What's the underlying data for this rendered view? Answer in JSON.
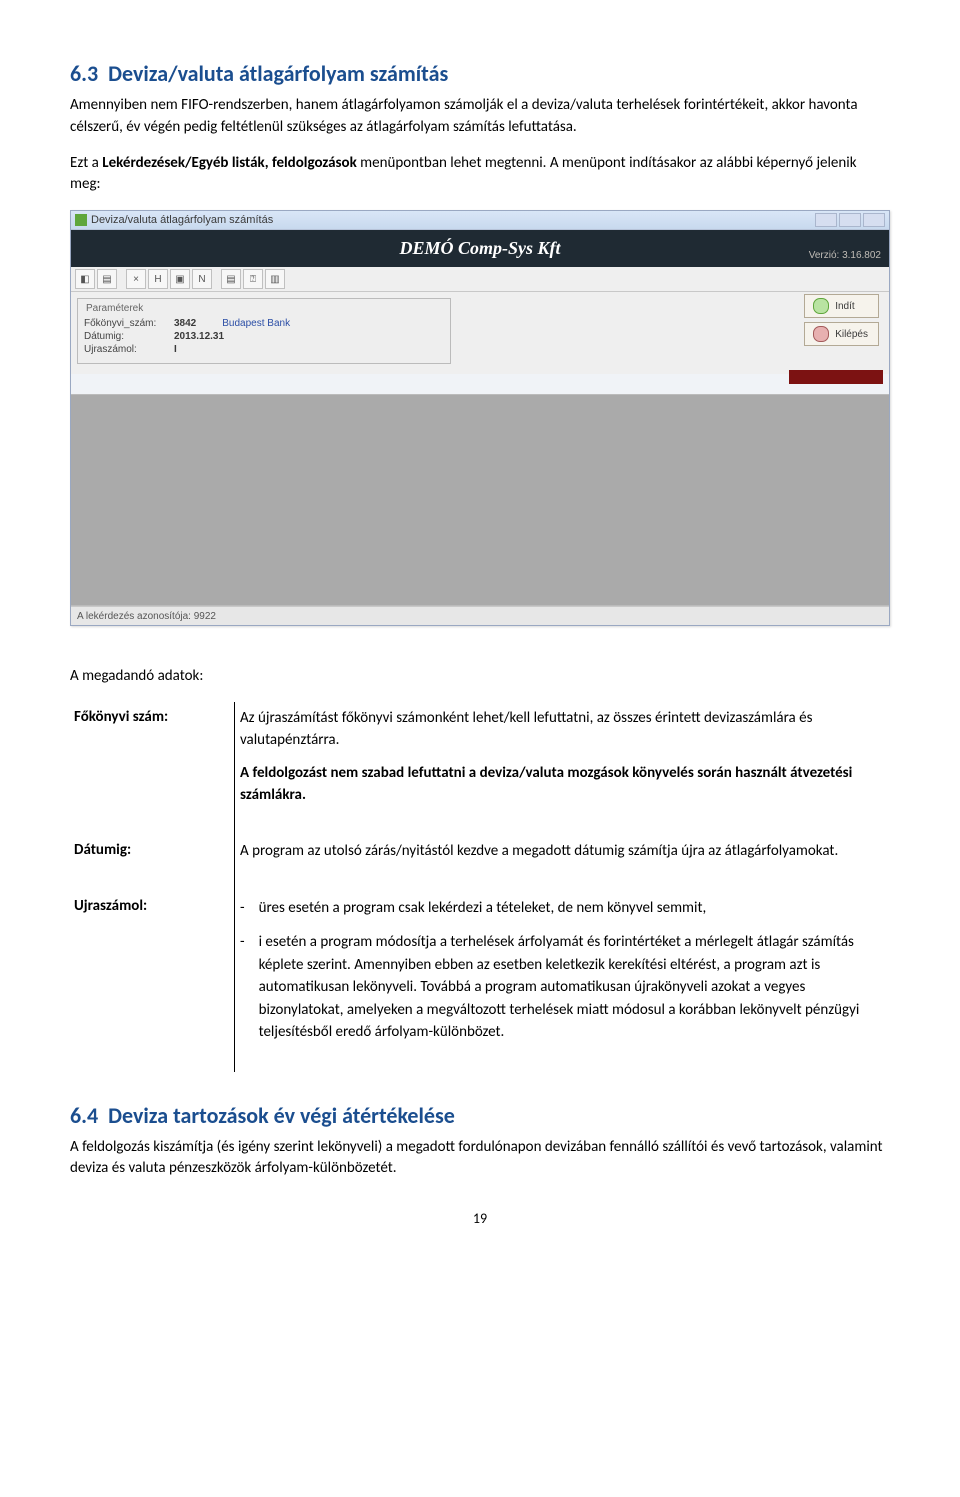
{
  "section63": {
    "number": "6.3",
    "title": "Deviza/valuta átlagárfolyam számítás",
    "para1": "Amennyiben nem FIFO-rendszerben, hanem átlagárfolyamon számolják el a deviza/valuta terhelések forintértékeit, akkor havonta célszerű, év végén pedig feltétlenül szükséges az átlagárfolyam számítás lefuttatása.",
    "para2a": "Ezt a ",
    "para2b": "Lekérdezések/Egyéb listák, feldolgozások",
    "para2c": " menüpontban lehet megtenni. A menüpont indításakor az alábbi képernyő jelenik meg:"
  },
  "win": {
    "title": "Deviza/valuta átlagárfolyam számítás",
    "banner": "DEMÓ Comp-Sys Kft",
    "version": "Verzió: 3.16.802",
    "params_title": "Paraméterek",
    "row1_label": "Főkönyvi_szám:",
    "row1_value": "3842",
    "row1_value2": "Budapest Bank",
    "row2_label": "Dátumig:",
    "row2_value": "2013.12.31",
    "row3_label": "Ujraszámol:",
    "row3_value": "I",
    "btn_start": "Indít",
    "btn_stop": "Kilépés",
    "status": "A lekérdezés azonosítója: 9922"
  },
  "defs": {
    "intro": "A megadandó adatok:",
    "fokonyvi_term": "Főkönyvi szám:",
    "fokonyvi_p1": "Az újraszámítást főkönyvi számonként lehet/kell lefuttatni, az összes érintett devizaszámlára és valutapénztárra.",
    "fokonyvi_p2": "A feldolgozást nem szabad lefuttatni a deviza/valuta mozgások könyvelés során használt átvezetési számlákra.",
    "datumig_term": "Dátumig:",
    "datumig_p1": "A program az utolsó zárás/nyitástól kezdve a megadott dátumig számítja újra az átlagárfolyamokat.",
    "ujra_term": "Ujraszámol:",
    "ujra_li1": "üres esetén a program csak lekérdezi a tételeket, de nem könyvel semmit,",
    "ujra_li2": "i esetén a program módosítja a terhelések árfolyamát és forintértéket a mérlegelt átlagár számítás képlete szerint. Amennyiben ebben az esetben keletkezik kerekítési eltérést, a program azt is automatikusan lekönyveli. Továbbá a program automatikusan újrakönyveli azokat a vegyes bizonylatokat, amelyeken a megváltozott terhelések miatt módosul a korábban lekönyvelt pénzügyi teljesítésből eredő árfolyam-különbözet."
  },
  "section64": {
    "number": "6.4",
    "title": "Deviza tartozások év végi átértékelése",
    "para": "A feldolgozás kiszámítja (és igény szerint lekönyveli) a megadott fordulónapon devizában fennálló szállítói és vevő tartozások, valamint deviza és valuta pénzeszközök árfolyam-különbözetét."
  },
  "page_number": "19"
}
